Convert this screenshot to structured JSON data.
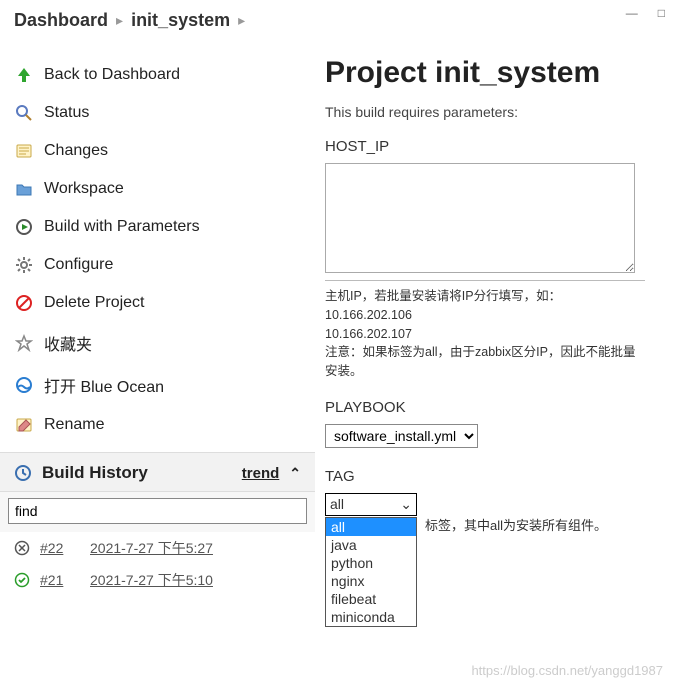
{
  "window": {
    "min": "—",
    "max": "□"
  },
  "crumbs": {
    "a": "Dashboard",
    "b": "init_system"
  },
  "nav": {
    "back": "Back to Dashboard",
    "status": "Status",
    "changes": "Changes",
    "workspace": "Workspace",
    "build_params": "Build with Parameters",
    "configure": "Configure",
    "delete": "Delete Project",
    "fav": "收藏夹",
    "blueocean": "打开 Blue Ocean",
    "rename": "Rename"
  },
  "history": {
    "title": "Build History",
    "trend": "trend",
    "find_value": "find",
    "rows": [
      {
        "status": "cancel",
        "num": "#22",
        "time": "2021-7-27 下午5:27"
      },
      {
        "status": "ok",
        "num": "#21",
        "time": "2021-7-27 下午5:10"
      }
    ]
  },
  "main": {
    "title": "Project init_system",
    "requires": "This build requires parameters:",
    "hostip": {
      "label": "HOST_IP",
      "hint_l1": "主机IP，若批量安装请将IP分行填写，如：",
      "hint_l2": "10.166.202.106",
      "hint_l3": "10.166.202.107",
      "hint_l4": "注意：如果标签为all，由于zabbix区分IP，因此不能批量安装。"
    },
    "playbook": {
      "label": "PLAYBOOK",
      "value": "software_install.yml"
    },
    "tag": {
      "label": "TAG",
      "value": "all",
      "options": [
        "all",
        "java",
        "python",
        "nginx",
        "filebeat",
        "miniconda"
      ],
      "hint": "标签，其中all为安装所有组件。"
    }
  },
  "watermark": "https://blog.csdn.net/yanggd1987"
}
